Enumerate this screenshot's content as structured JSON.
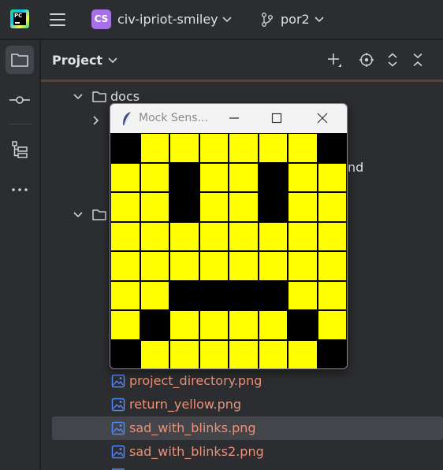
{
  "titlebar": {
    "project_badge": "CS",
    "project_name": "civ-ipriot-smiley",
    "branch_name": "por2"
  },
  "panel": {
    "title": "Project"
  },
  "tree": {
    "rows": [
      {
        "label": "docs",
        "kind": "folder",
        "expanded": true
      },
      {
        "label": "",
        "kind": "folder",
        "expanded": false
      },
      {
        "label": "nd",
        "kind": "partial"
      },
      {
        "label": "",
        "kind": "folder",
        "expanded": true
      },
      {
        "label": "project_directory.png",
        "kind": "image"
      },
      {
        "label": "return_yellow.png",
        "kind": "image"
      },
      {
        "label": "sad_with_blinks.png",
        "kind": "image",
        "selected": true
      },
      {
        "label": "sad_with_blinks2.png",
        "kind": "image"
      }
    ]
  },
  "tk_window": {
    "title": "Mock Sens...",
    "grid_rows": 8,
    "grid_cols": 8,
    "colors": {
      "on": "#ffff00",
      "off": "#000000"
    },
    "pixels": [
      "OYYYYYYO",
      "YYOYYOYY",
      "YYOYYOYY",
      "YYYYYYYY",
      "YYYYYYYY",
      "YYOOOOYY",
      "YOYYYYOY",
      "OYYYYYYO"
    ]
  },
  "colors": {
    "background": "#2b2d30",
    "file_text": "#e8937a",
    "selected_row": "#43454a",
    "badge": "#a571e6"
  }
}
